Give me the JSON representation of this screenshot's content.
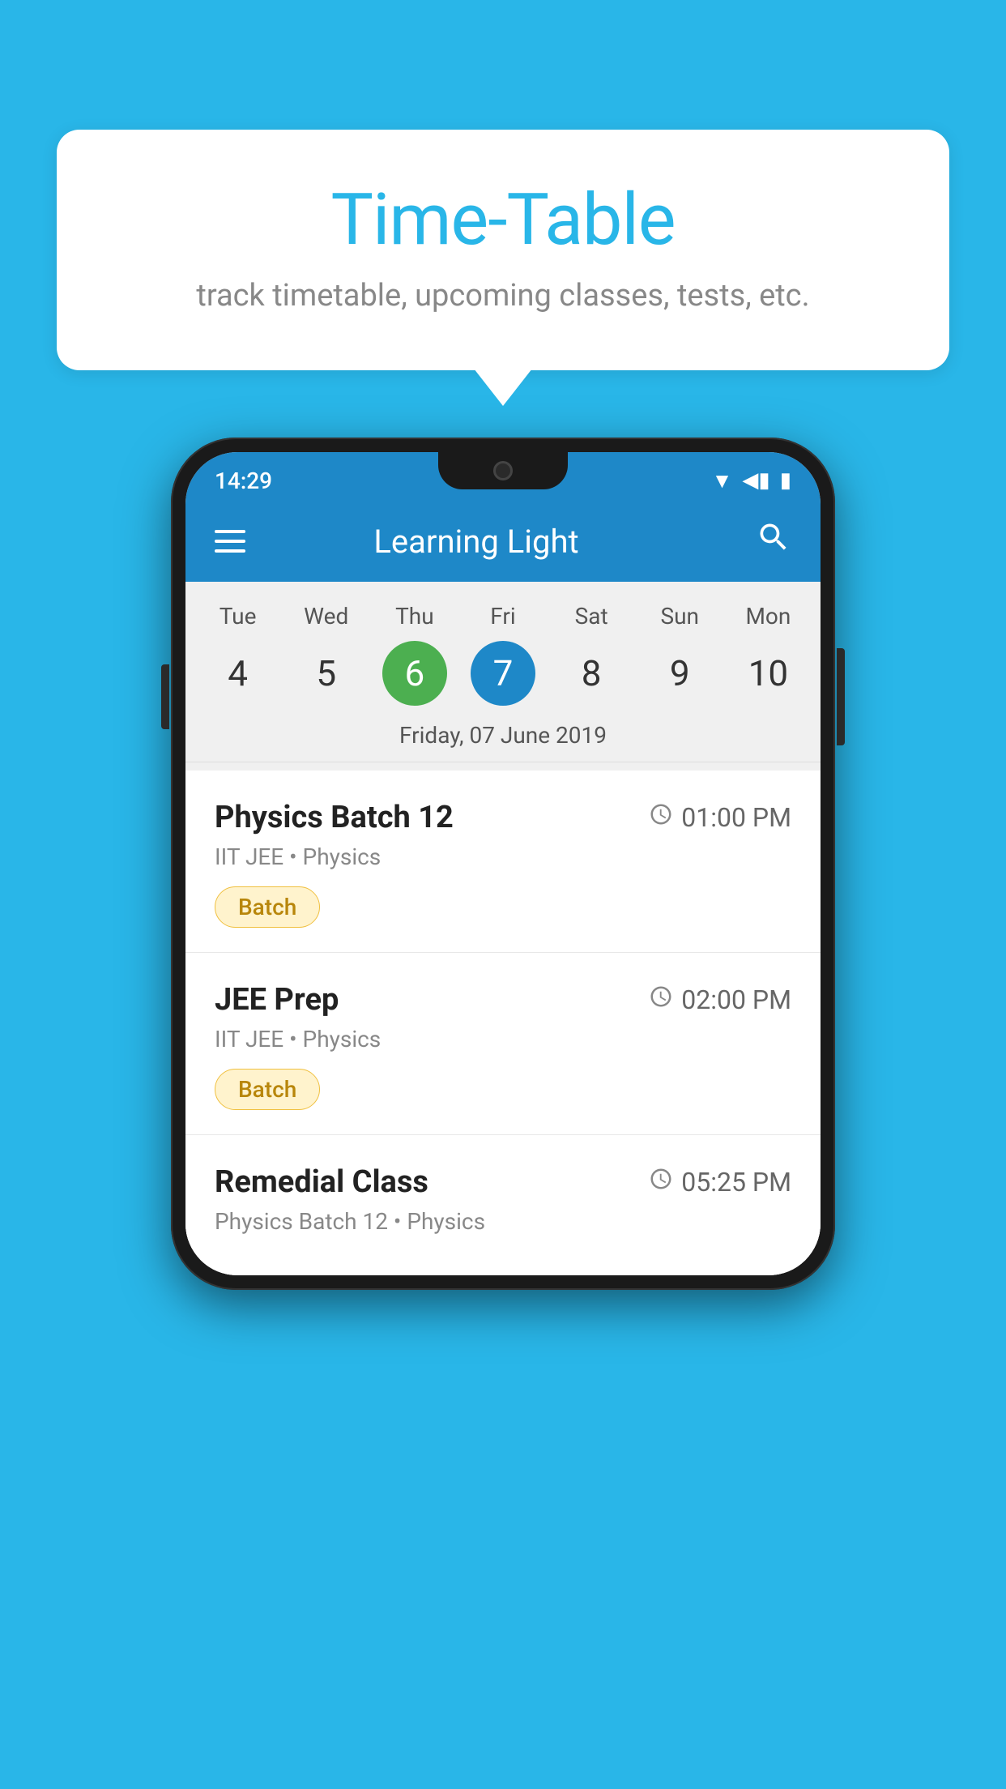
{
  "background_color": "#29B6E8",
  "speech_bubble": {
    "title": "Time-Table",
    "subtitle": "track timetable, upcoming classes, tests, etc."
  },
  "phone": {
    "status_bar": {
      "time": "14:29"
    },
    "app_bar": {
      "title": "Learning Light"
    },
    "calendar": {
      "days": [
        "Tue",
        "Wed",
        "Thu",
        "Fri",
        "Sat",
        "Sun",
        "Mon"
      ],
      "dates": [
        "4",
        "5",
        "6",
        "7",
        "8",
        "9",
        "10"
      ],
      "today_index": 2,
      "selected_index": 3,
      "selected_date_label": "Friday, 07 June 2019"
    },
    "classes": [
      {
        "name": "Physics Batch 12",
        "time": "01:00 PM",
        "meta": "IIT JEE • Physics",
        "tag": "Batch"
      },
      {
        "name": "JEE Prep",
        "time": "02:00 PM",
        "meta": "IIT JEE • Physics",
        "tag": "Batch"
      },
      {
        "name": "Remedial Class",
        "time": "05:25 PM",
        "meta": "Physics Batch 12 • Physics",
        "tag": null
      }
    ]
  }
}
